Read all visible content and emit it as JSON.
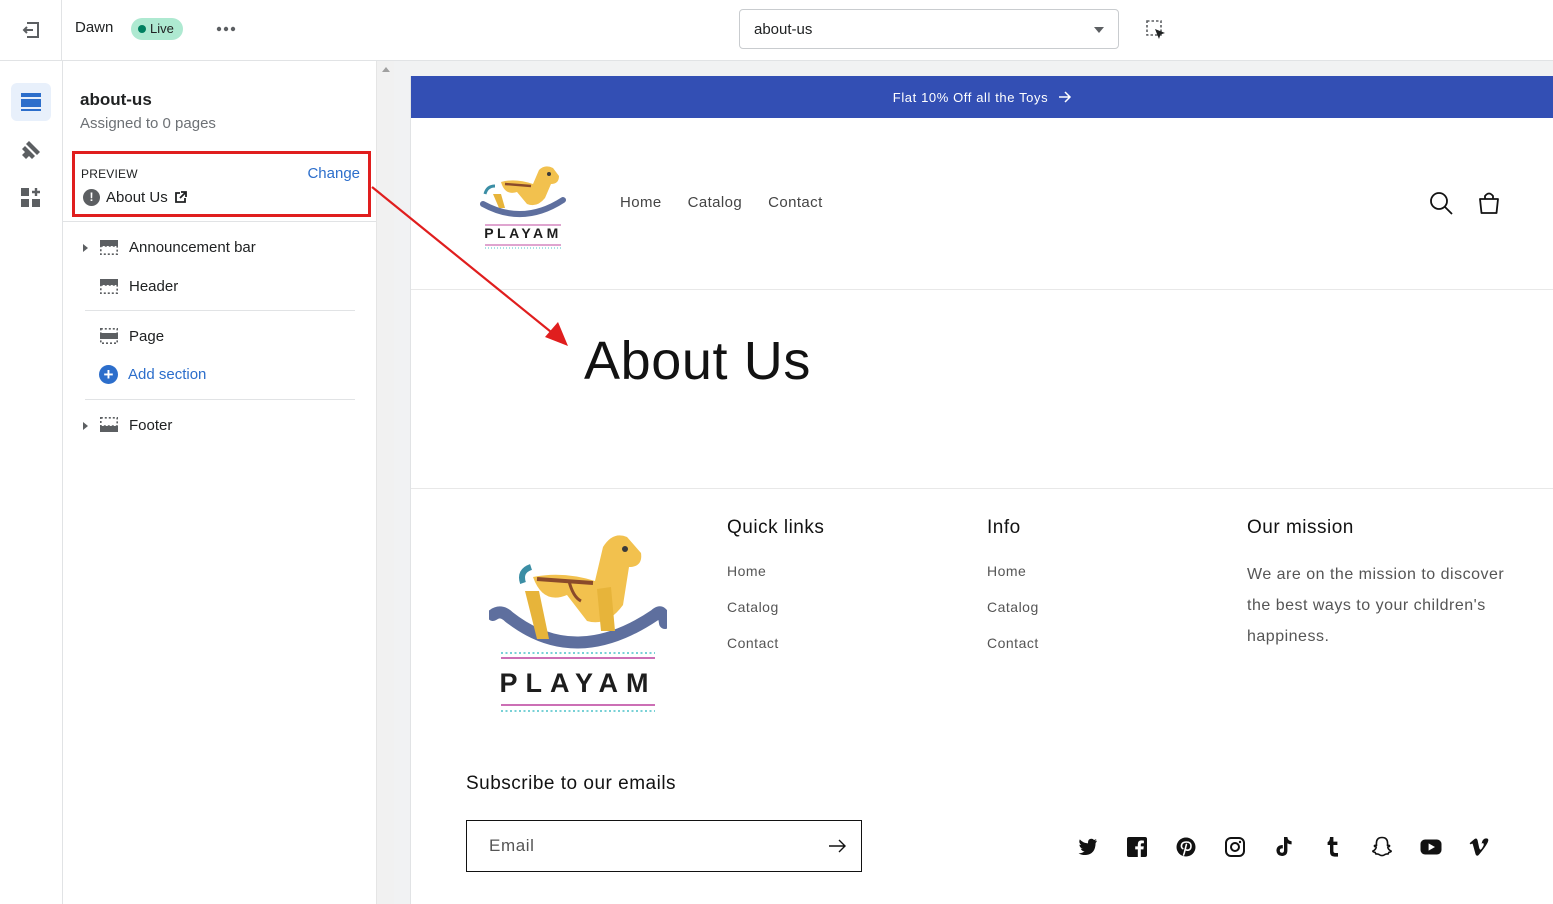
{
  "topbar": {
    "theme_name": "Dawn",
    "status_badge": "Live",
    "page_selector_value": "about-us"
  },
  "icons": {
    "exit": "exit-icon",
    "more": "more-horizontal-icon",
    "inspector": "select-inspector-icon",
    "sections": "sections-icon",
    "theme_settings": "paint-brush-icon",
    "apps": "apps-icon"
  },
  "sidebar": {
    "template_title": "about-us",
    "assigned_text": "Assigned to 0 pages",
    "preview": {
      "label": "PREVIEW",
      "change_label": "Change",
      "page_name": "About Us"
    },
    "sections": {
      "announcement_bar": "Announcement bar",
      "header": "Header",
      "page": "Page",
      "add_section": "Add section",
      "footer": "Footer"
    }
  },
  "store": {
    "announcement": "Flat 10% Off all the Toys",
    "brand": "PLAYAM",
    "nav": [
      "Home",
      "Catalog",
      "Contact"
    ],
    "page_heading": "About Us",
    "footer": {
      "quick_links": {
        "heading": "Quick links",
        "links": [
          "Home",
          "Catalog",
          "Contact"
        ]
      },
      "info": {
        "heading": "Info",
        "links": [
          "Home",
          "Catalog",
          "Contact"
        ]
      },
      "mission": {
        "heading": "Our mission",
        "text": "We are on the mission to discover the best ways to your children's happiness."
      },
      "subscribe_title": "Subscribe to our emails",
      "email_placeholder": "Email",
      "socials": [
        "twitter-icon",
        "facebook-icon",
        "pinterest-icon",
        "instagram-icon",
        "tiktok-icon",
        "tumblr-icon",
        "snapchat-icon",
        "youtube-icon",
        "vimeo-icon"
      ]
    }
  },
  "colors": {
    "announcement_bg": "#334fb4",
    "accent": "#2c6ecb",
    "live_badge": "#aee9d1",
    "annotation": "#e01e1e"
  }
}
